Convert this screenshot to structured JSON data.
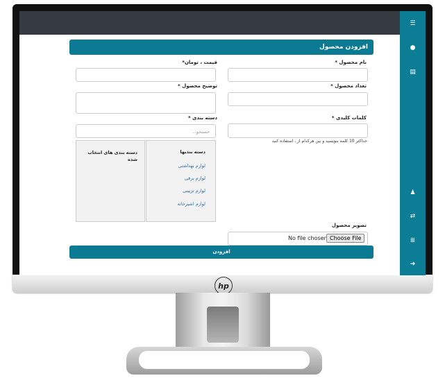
{
  "form": {
    "title": "افزودن محصول",
    "product_name_label": "نام محصول *",
    "price_label": "قیمت ، تومان*",
    "quantity_label": "تعداد محصول *",
    "description_label": "توضیح محصول *",
    "keywords_label": "کلمات کلیدی *",
    "keywords_hint": "حداکثر 10 کلمه بنویسید و بین هرکدام از ، استفاده کنید",
    "category_label": "دسته بندی *",
    "category_search_placeholder": "جستجو...",
    "categories_header": "دسته بندیها",
    "categories": [
      "لوازم بهداشتی",
      "لوازم برقی",
      "لوازم تزیینی",
      "لوازم اشپزخانه"
    ],
    "selected_header": "دسته بندی های انتخاب شده",
    "image_label": "تصویر محصول",
    "file_button": "Choose File",
    "file_status": "No file chosen",
    "submit_label": "افزودن"
  },
  "sidebar_icons": [
    "menu-icon",
    "dashboard-icon",
    "product-icon",
    "user-icon",
    "transfer-icon",
    "list-icon",
    "logout-icon"
  ],
  "brand": {
    "logo_text": "hp",
    "accent": "#0d7a94",
    "sidebar_color": "#0b7e95",
    "topbar_color": "#343a40"
  }
}
